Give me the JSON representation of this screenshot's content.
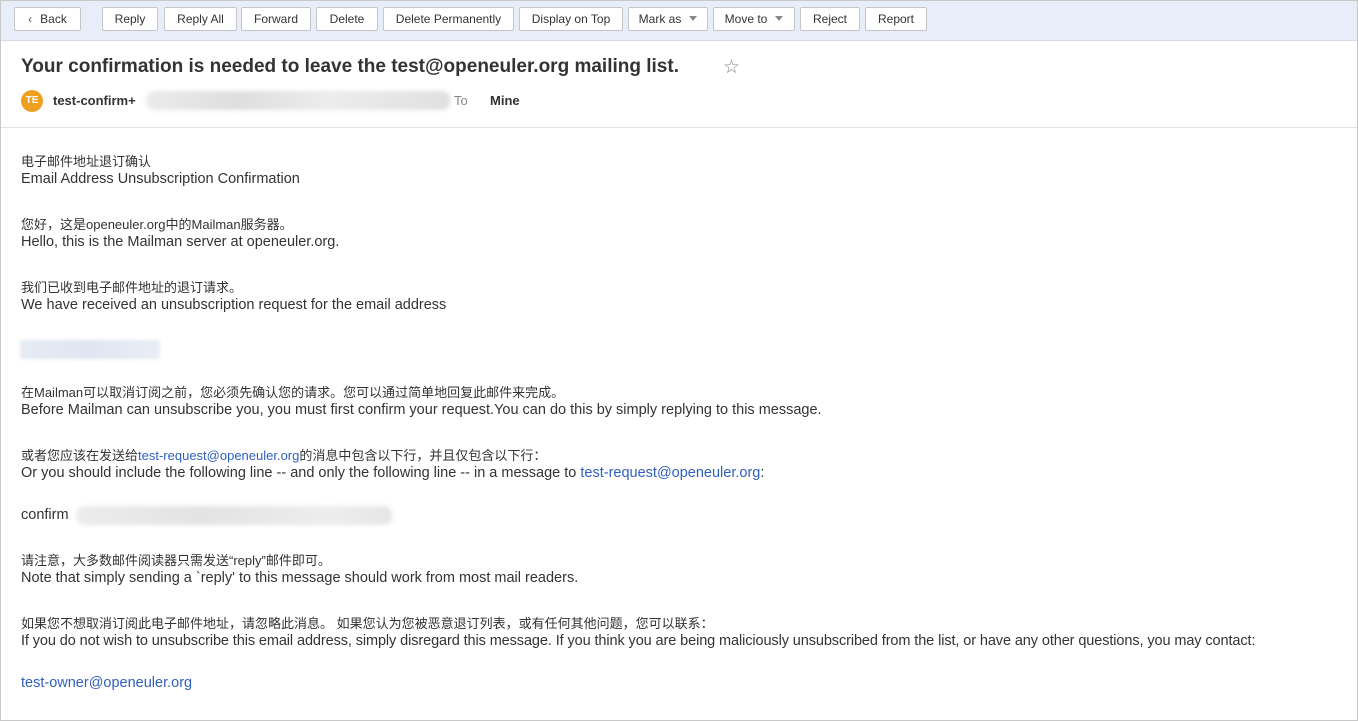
{
  "toolbar": {
    "back": "Back",
    "reply": "Reply",
    "reply_all": "Reply All",
    "forward": "Forward",
    "delete": "Delete",
    "delete_permanently": "Delete Permanently",
    "display_on_top": "Display on Top",
    "mark_as": "Mark as",
    "move_to": "Move to",
    "reject": "Reject",
    "report": "Report"
  },
  "header": {
    "subject": "Your confirmation is needed to leave the test@openeuler.org mailing list.",
    "star_icon": "☆",
    "avatar_initials": "TE",
    "sender": "test-confirm+",
    "to_label": "To",
    "to_value": "Mine"
  },
  "message": {
    "l1": "电子邮件地址退订确认",
    "l2": "Email Address Unsubscription Confirmation",
    "l3": "您好，这是openeuler.org中的Mailman服务器。",
    "l4": "Hello, this is the Mailman server at openeuler.org.",
    "l5": "我们已收到电子邮件地址的退订请求。",
    "l6": "We have received an unsubscription request for the email address",
    "l7": "在Mailman可以取消订阅之前，您必须先确认您的请求。您可以通过简单地回复此邮件来完成。",
    "l8": "Before Mailman can unsubscribe you, you must first confirm your request.You can do this by simply replying to this message.",
    "l9_pre": "或者您应该在发送给",
    "l9_link": "test-request@openeuler.org",
    "l9_post": "的消息中包含以下行，并且仅包含以下行：",
    "l10_pre": "Or you should include the following line -- and only the following line -- in a message to ",
    "l10_link": "test-request@openeuler.org",
    "l10_post": ":",
    "l11": "confirm",
    "l12": "请注意，大多数邮件阅读器只需发送“reply”邮件即可。",
    "l13": "Note that simply sending a `reply' to this message should work from most mail readers.",
    "l14": "如果您不想取消订阅此电子邮件地址，请忽略此消息。 如果您认为您被恶意退订列表，或有任何其他问题，您可以联系：",
    "l15": "If you do not wish to unsubscribe this email address, simply disregard this message. If you think you are being maliciously unsubscribed from the list, or have any other questions, you may contact:",
    "l16_link": "test-owner@openeuler.org"
  },
  "colors": {
    "toolbar_bg": "#e7eef9",
    "link": "#2f5fbf",
    "avatar": "#f0a020"
  }
}
